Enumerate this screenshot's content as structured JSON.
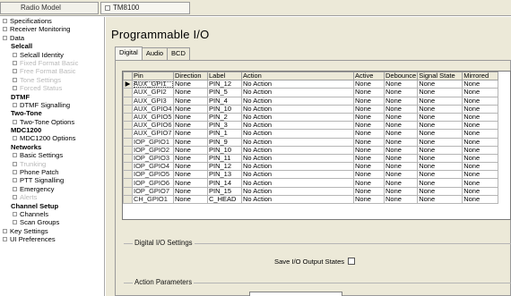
{
  "topbar": {
    "radio_model_label": "Radio Model",
    "model_value": "TM8100"
  },
  "sidebar": {
    "items": [
      {
        "label": "Specifications",
        "kind": "l0"
      },
      {
        "label": "Receiver Monitoring",
        "kind": "l0"
      },
      {
        "label": "Data",
        "kind": "l0"
      },
      {
        "label": "Selcall",
        "kind": "header"
      },
      {
        "label": "Selcall Identity",
        "kind": "l1"
      },
      {
        "label": "Fixed Format Basic",
        "kind": "l1-disabled"
      },
      {
        "label": "Free Format Basic",
        "kind": "l1-disabled"
      },
      {
        "label": "Tone Settings",
        "kind": "l1-disabled"
      },
      {
        "label": "Forced Status",
        "kind": "l1-disabled"
      },
      {
        "label": "DTMF",
        "kind": "header"
      },
      {
        "label": "DTMF Signalling",
        "kind": "l1"
      },
      {
        "label": "Two-Tone",
        "kind": "header"
      },
      {
        "label": "Two-Tone Options",
        "kind": "l1"
      },
      {
        "label": "MDC1200",
        "kind": "header"
      },
      {
        "label": "MDC1200 Options",
        "kind": "l1"
      },
      {
        "label": "Networks",
        "kind": "header"
      },
      {
        "label": "Basic Settings",
        "kind": "l1"
      },
      {
        "label": "Trunking",
        "kind": "l1-disabled"
      },
      {
        "label": "Phone Patch",
        "kind": "l1"
      },
      {
        "label": "PTT Signalling",
        "kind": "l1"
      },
      {
        "label": "Emergency",
        "kind": "l1"
      },
      {
        "label": "Alerts",
        "kind": "l1-disabled"
      },
      {
        "label": "Channel Setup",
        "kind": "header"
      },
      {
        "label": "Channels",
        "kind": "l1"
      },
      {
        "label": "Scan Groups",
        "kind": "l1"
      },
      {
        "label": "Key Settings",
        "kind": "l0"
      },
      {
        "label": "UI Preferences",
        "kind": "l0"
      }
    ]
  },
  "main": {
    "title": "Programmable I/O",
    "tabs": [
      "Digital",
      "Audio",
      "BCD"
    ],
    "active_tab": "Digital"
  },
  "grid": {
    "columns": [
      "Pin",
      "Direction",
      "Label",
      "Action",
      "Active",
      "Debounce",
      "Signal State",
      "Mirrored"
    ],
    "rows": [
      [
        "AUX_GPI1",
        "None",
        "PIN_12",
        "No Action",
        "None",
        "None",
        "None",
        "None"
      ],
      [
        "AUX_GPI2",
        "None",
        "PIN_5",
        "No Action",
        "None",
        "None",
        "None",
        "None"
      ],
      [
        "AUX_GPI3",
        "None",
        "PIN_4",
        "No Action",
        "None",
        "None",
        "None",
        "None"
      ],
      [
        "AUX_GPIO4",
        "None",
        "PIN_10",
        "No Action",
        "None",
        "None",
        "None",
        "None"
      ],
      [
        "AUX_GPIO5",
        "None",
        "PIN_2",
        "No Action",
        "None",
        "None",
        "None",
        "None"
      ],
      [
        "AUX_GPIO6",
        "None",
        "PIN_3",
        "No Action",
        "None",
        "None",
        "None",
        "None"
      ],
      [
        "AUX_GPIO7",
        "None",
        "PIN_1",
        "No Action",
        "None",
        "None",
        "None",
        "None"
      ],
      [
        "IOP_GPIO1",
        "None",
        "PIN_9",
        "No Action",
        "None",
        "None",
        "None",
        "None"
      ],
      [
        "IOP_GPIO2",
        "None",
        "PIN_10",
        "No Action",
        "None",
        "None",
        "None",
        "None"
      ],
      [
        "IOP_GPIO3",
        "None",
        "PIN_11",
        "No Action",
        "None",
        "None",
        "None",
        "None"
      ],
      [
        "IOP_GPIO4",
        "None",
        "PIN_12",
        "No Action",
        "None",
        "None",
        "None",
        "None"
      ],
      [
        "IOP_GPIO5",
        "None",
        "PIN_13",
        "No Action",
        "None",
        "None",
        "None",
        "None"
      ],
      [
        "IOP_GPIO6",
        "None",
        "PIN_14",
        "No Action",
        "None",
        "None",
        "None",
        "None"
      ],
      [
        "IOP_GPIO7",
        "None",
        "PIN_15",
        "No Action",
        "None",
        "None",
        "None",
        "None"
      ],
      [
        "CH_GPIO1",
        "None",
        "C_HEAD",
        "No Action",
        "None",
        "None",
        "None",
        "None"
      ]
    ]
  },
  "digital_io_settings": {
    "group_label": "Digital I/O Settings",
    "save_label": "Save I/O Output States",
    "save_checked": false
  },
  "action_parameters": {
    "group_label": "Action Parameters"
  }
}
